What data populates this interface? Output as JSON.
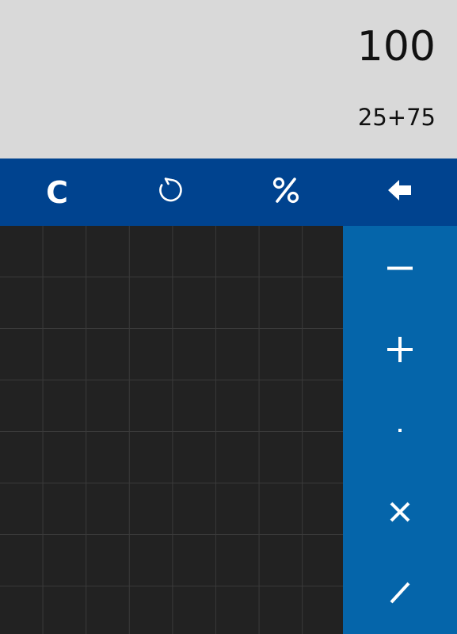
{
  "display": {
    "result": "100",
    "expression": "25+75"
  },
  "toolbar": {
    "clear_label": "C",
    "refresh_icon": "refresh-icon",
    "percent_icon": "percent-icon",
    "backspace_icon": "backspace-icon"
  },
  "operators": [
    {
      "icon": "minus-icon"
    },
    {
      "icon": "plus-icon"
    },
    {
      "icon": "decimal-point-icon"
    },
    {
      "icon": "multiply-icon"
    },
    {
      "icon": "divide-icon"
    }
  ],
  "colors": {
    "display_bg": "#d9d9d9",
    "toolbar_bg": "#00438f",
    "operator_bg": "#0565aa",
    "pad_bg": "#222222"
  }
}
